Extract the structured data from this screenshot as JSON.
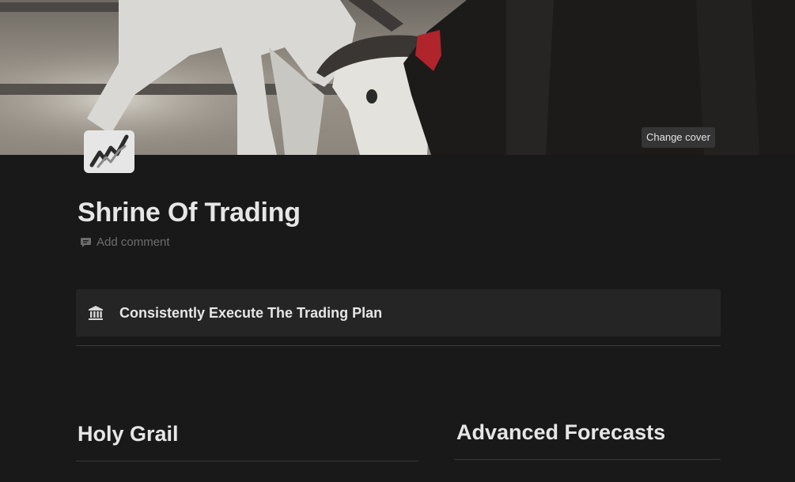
{
  "cover": {
    "change_label": "Change cover"
  },
  "page": {
    "title": "Shrine Of Trading",
    "add_comment": "Add comment"
  },
  "callout": {
    "icon": "bank-icon",
    "text": "Consistently Execute The Trading Plan"
  },
  "columns": [
    {
      "heading": "Holy Grail"
    },
    {
      "heading": "Advanced Forecasts"
    }
  ],
  "colors": {
    "background": "#191919",
    "callout_bg": "#252525",
    "text": "#e6e6e6",
    "muted": "#6e6e6e"
  }
}
